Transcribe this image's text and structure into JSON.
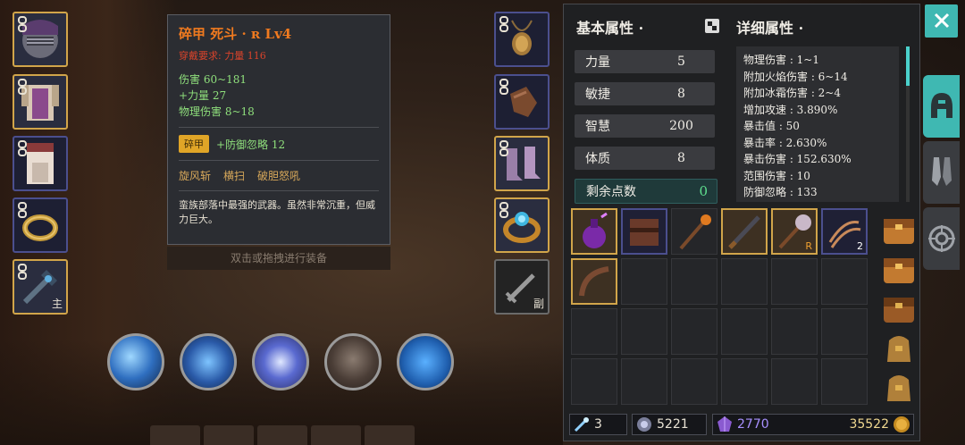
{
  "tooltip": {
    "title": "碎甲  死斗 · ʀ Lv4",
    "requirement": "穿戴要求:    力量 116",
    "stats": [
      "伤害   60~181",
      "+力量  27",
      "物理伤害  8~18"
    ],
    "gem_tag": "碎甲",
    "gem_effect": "+防御忽略  12",
    "skills": [
      "旋风斩",
      "横扫",
      "破胆怒吼"
    ],
    "description": "蛮族部落中最强的武器。虽然非常沉重，但威力巨大。",
    "hint": "双击或拖拽进行装备"
  },
  "equip_slots": {
    "main_hand_tag": "主",
    "off_hand_tag": "副"
  },
  "panel": {
    "basic_header": "基本属性 ·",
    "detail_header": "详细属性 ·",
    "basic_stats": [
      {
        "label": "力量",
        "value": "5"
      },
      {
        "label": "敏捷",
        "value": "8"
      },
      {
        "label": "智慧",
        "value": "200"
      },
      {
        "label": "体质",
        "value": "8"
      }
    ],
    "remaining": {
      "label": "剩余点数",
      "value": "0"
    },
    "detail_stats": [
      "物理伤害 : 1~1",
      "附加火焰伤害 : 6~14",
      "附加冰霜伤害 : 2~4",
      "增加攻速 : 3.890%",
      "暴击值 : 50",
      "暴击率 : 2.630%",
      "暴击伤害 : 152.630%",
      "范围伤害 : 10",
      "防御忽略 : 133"
    ]
  },
  "inventory": {
    "items": [
      {
        "name": "purple-potion",
        "border": "gold"
      },
      {
        "name": "leather-armor",
        "border": "blue"
      },
      {
        "name": "torch-staff",
        "border": "grey"
      },
      {
        "name": "dark-sword",
        "border": "gold"
      },
      {
        "name": "spiked-mace",
        "border": "gold",
        "rarity": "R"
      },
      {
        "name": "claws",
        "border": "blue",
        "qty": "2"
      },
      {
        "name": "wooden-bow",
        "border": "gold"
      }
    ]
  },
  "currency": {
    "gems": "3",
    "silver": "5221",
    "crystals": "2770",
    "gold": "35522"
  },
  "colors": {
    "accent": "#3fb8b2",
    "gold_border": "#d1a54a",
    "blue_border": "#4b4f8e",
    "stat_green": "#8fe07c",
    "title_orange": "#f07a1f"
  },
  "icons": [
    "close-icon",
    "helmet-icon",
    "gloves-icon",
    "target-icon",
    "chain-icon",
    "swap-icon"
  ]
}
